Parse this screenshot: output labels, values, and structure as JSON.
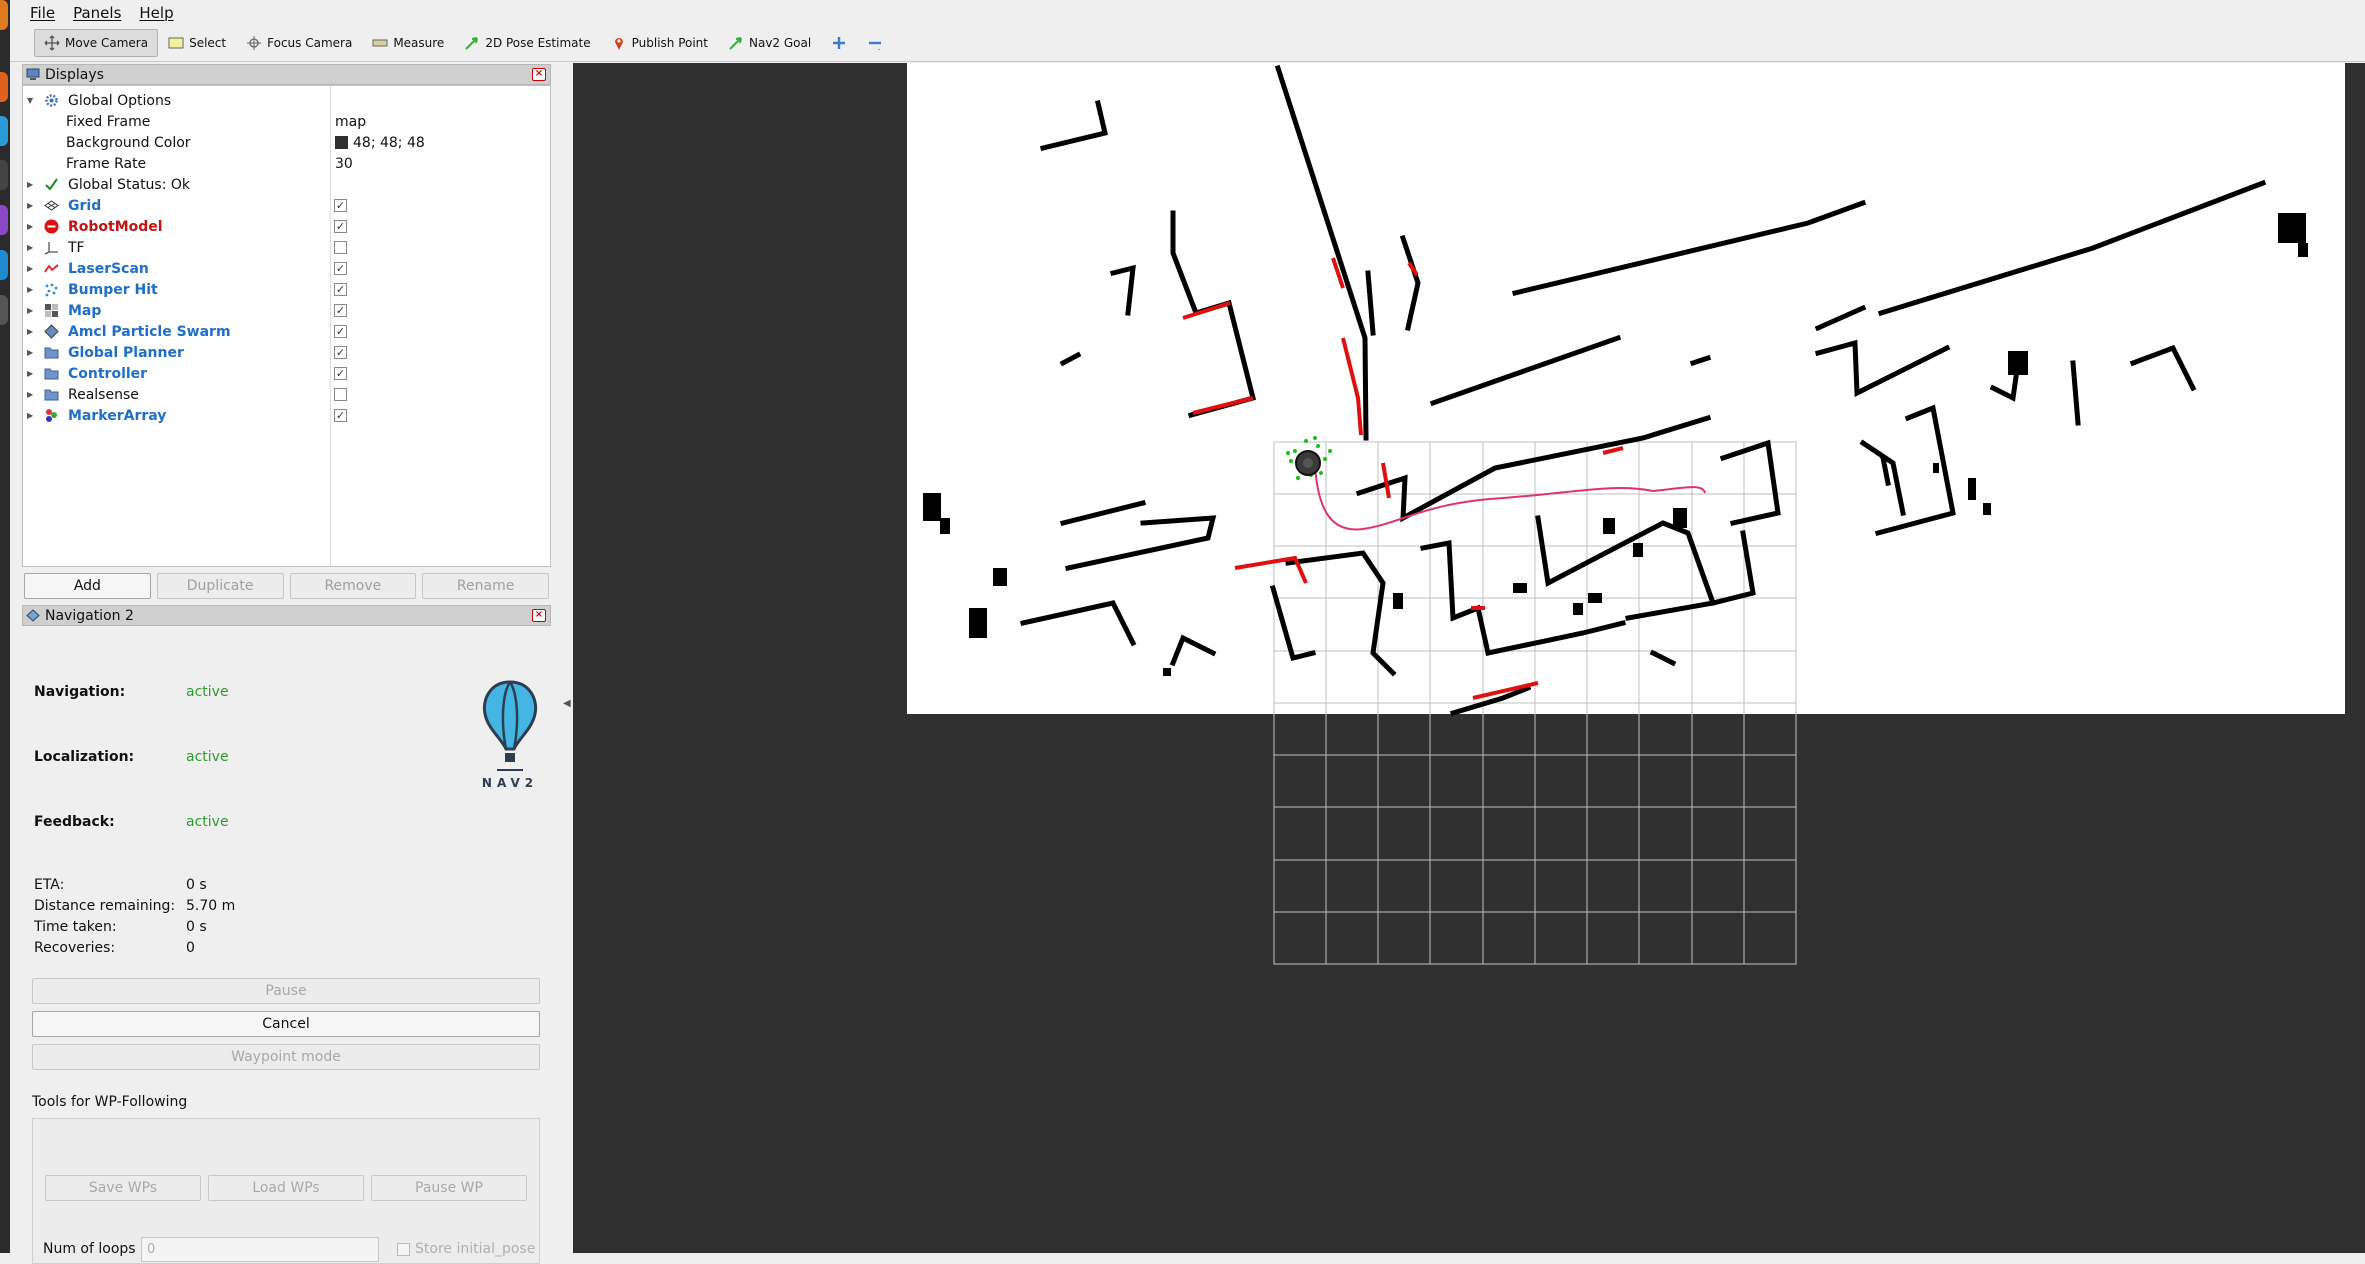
{
  "menubar": {
    "items": [
      "File",
      "Panels",
      "Help"
    ]
  },
  "toolbar": {
    "tools": [
      "Move Camera",
      "Select",
      "Focus Camera",
      "Measure",
      "2D Pose Estimate",
      "Publish Point",
      "Nav2 Goal"
    ]
  },
  "displays": {
    "title": "Displays",
    "global_options": "Global Options",
    "fixed_frame_label": "Fixed Frame",
    "fixed_frame_value": "map",
    "background_color_label": "Background Color",
    "background_color_value": "48; 48; 48",
    "background_color_hex": "#303030",
    "frame_rate_label": "Frame Rate",
    "frame_rate_value": "30",
    "global_status": "Global Status: Ok",
    "items": [
      {
        "label": "Grid",
        "checked": true
      },
      {
        "label": "RobotModel",
        "checked": true
      },
      {
        "label": "TF",
        "checked": false
      },
      {
        "label": "LaserScan",
        "checked": true
      },
      {
        "label": "Bumper Hit",
        "checked": true
      },
      {
        "label": "Map",
        "checked": true
      },
      {
        "label": "Amcl Particle Swarm",
        "checked": true
      },
      {
        "label": "Global Planner",
        "checked": true
      },
      {
        "label": "Controller",
        "checked": true
      },
      {
        "label": "Realsense",
        "checked": false
      },
      {
        "label": "MarkerArray",
        "checked": true
      }
    ],
    "buttons": {
      "add": "Add",
      "duplicate": "Duplicate",
      "remove": "Remove",
      "rename": "Rename"
    }
  },
  "nav2": {
    "title": "Navigation 2",
    "navigation_label": "Navigation:",
    "navigation_value": "active",
    "localization_label": "Localization:",
    "localization_value": "active",
    "feedback_label": "Feedback:",
    "feedback_value": "active",
    "logo_text": "NAV2",
    "eta_label": "ETA:",
    "eta_value": "0 s",
    "distance_label": "Distance remaining:",
    "distance_value": "5.70 m",
    "time_label": "Time taken:",
    "time_value": "0 s",
    "recoveries_label": "Recoveries:",
    "recoveries_value": "0",
    "pause": "Pause",
    "cancel": "Cancel",
    "waypoint_mode": "Waypoint mode",
    "wp_tools_label": "Tools for WP-Following",
    "save_wps": "Save WPs",
    "load_wps": "Load WPs",
    "pause_wp": "Pause WP",
    "num_loops_label": "Num of loops",
    "num_loops_value": "0",
    "store_initial_pose": "Store initial_pose"
  },
  "colors": {
    "status_active": "#2a9d2a",
    "display_blue": "#1f6fc9",
    "robotmodel_red": "#c41212",
    "viewport_bg": "#303030",
    "path": "#e0336a",
    "laser": "#e01010",
    "particles": "#19c019"
  }
}
